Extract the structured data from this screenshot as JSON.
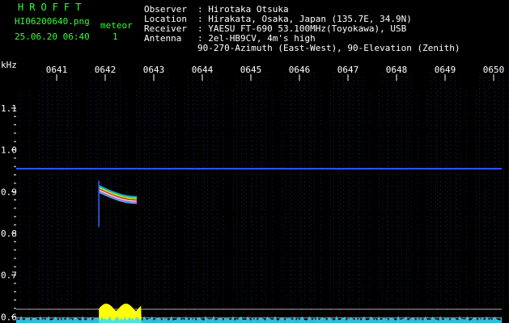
{
  "header": {
    "brand": "HROFFT",
    "filename": "HI06200640.png",
    "datetime": "25.06.20 06:40",
    "meteor_label": "meteor",
    "meteor_count": "1"
  },
  "info": {
    "observer_label": "Observer",
    "observer_value": ": Hirotaka Otsuka",
    "location_label": "Location",
    "location_value": ": Hirakata, Osaka, Japan (135.7E, 34.9N)",
    "receiver_label": "Receiver",
    "receiver_value": ": YAESU FT-690 53.100MHz(Toyokawa), USB",
    "antenna_label": "Antenna",
    "antenna_value": ": 2el-HB9CV, 4m's high",
    "antenna_value2": "90-270-Azimuth (East-West), 90-Elevation (Zenith)"
  },
  "chart_data": {
    "type": "spectrogram",
    "x_unit_label": "",
    "y_unit_label": "kHz",
    "x_ticks": [
      "0641",
      "0642",
      "0643",
      "0644",
      "0645",
      "0646",
      "0647",
      "0648",
      "0649",
      "0650"
    ],
    "y_ticks": [
      "1.1",
      "1.0",
      "0.9",
      "0.8",
      "0.7",
      "0.6"
    ],
    "y_tick_values": [
      1.1,
      1.0,
      0.9,
      0.8,
      0.7,
      0.6
    ],
    "y_range": [
      0.585,
      1.185
    ],
    "x_range_minutes": [
      0.5,
      10.0
    ],
    "carrier_khz": 0.955,
    "meteor": {
      "start_minute": 1.87,
      "end_minute": 2.65,
      "freq_khz_start": 0.895,
      "freq_khz_end": 0.88
    },
    "colors": {
      "background": "#000000",
      "grid": "#2a3a7a",
      "carrier": "#3355ff",
      "tick_label": "#ffffff",
      "activity": "#ffff00",
      "noise": "#33ddff"
    }
  }
}
